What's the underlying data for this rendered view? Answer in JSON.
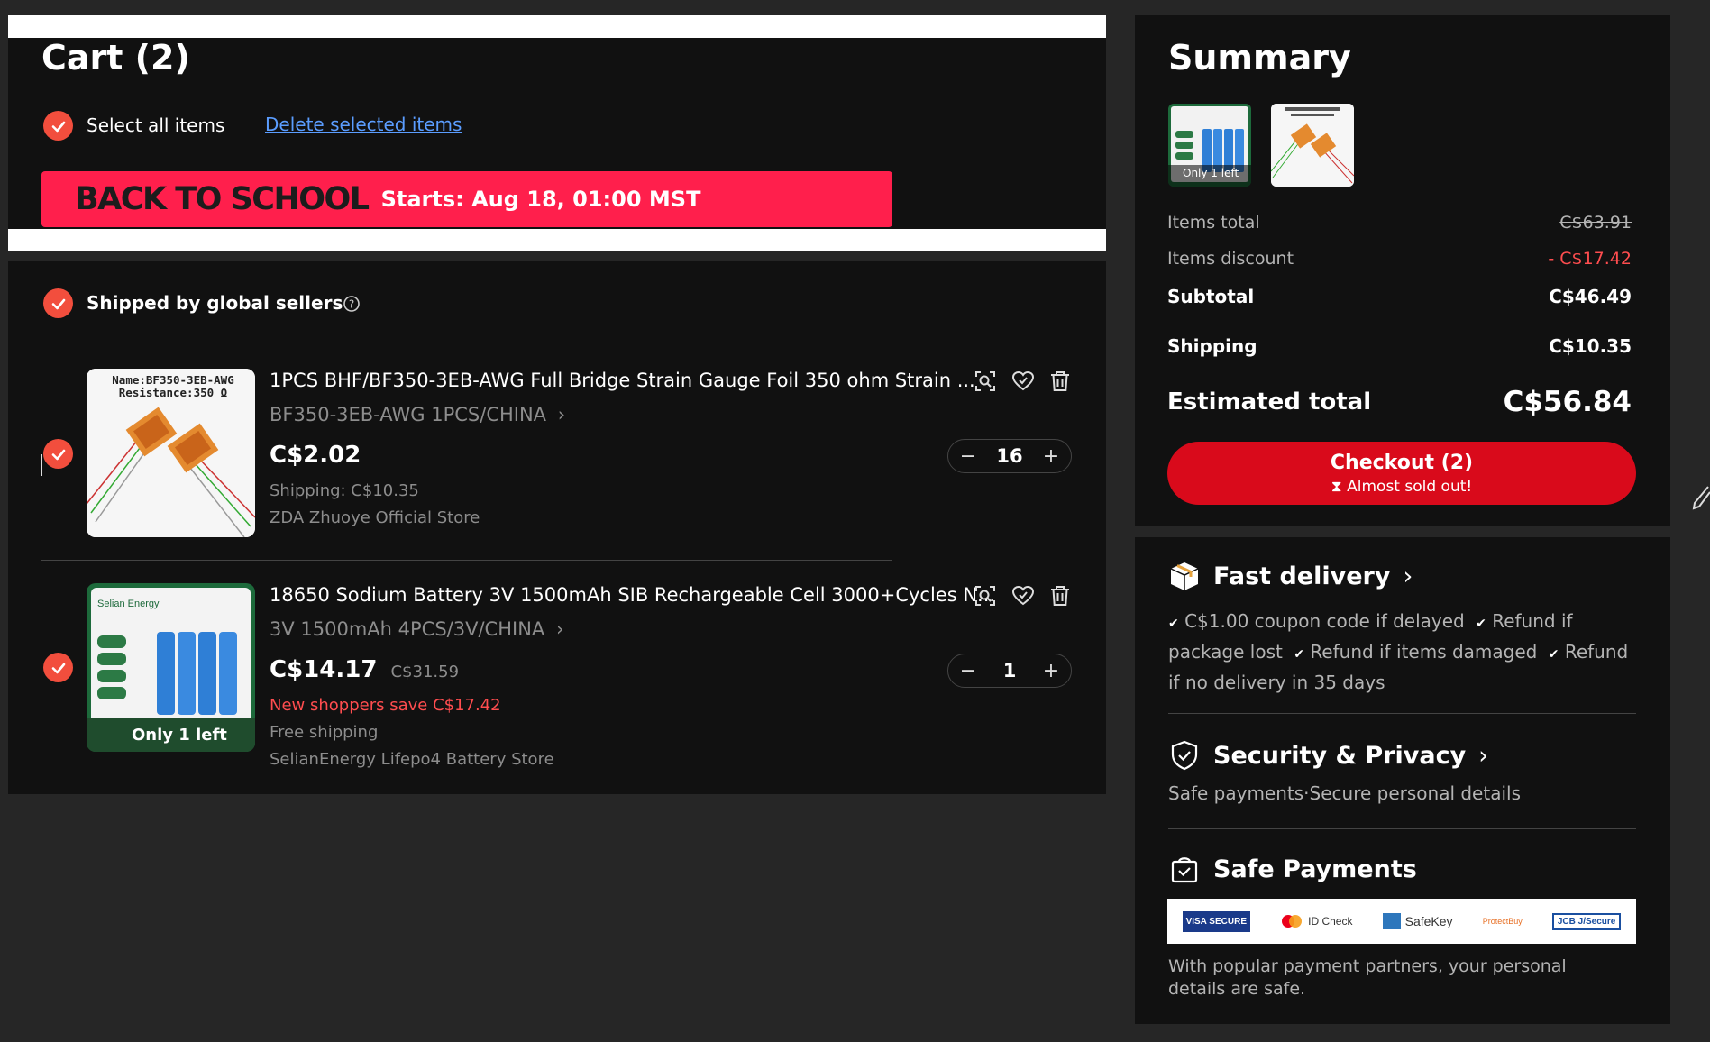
{
  "cart": {
    "title": "Cart (2)",
    "select_all": "Select all items",
    "delete_selected": "Delete selected items",
    "banner": {
      "title": "BACK TO SCHOOL",
      "starts": "Starts: Aug 18, 01:00 MST"
    },
    "group": {
      "label": "Shipped by global sellers"
    },
    "items": [
      {
        "title": "1PCS BHF/BF350-3EB-AWG Full Bridge Strain Gauge Foil 350 ohm Strain ...",
        "variant": "BF350-3EB-AWG 1PCS/CHINA",
        "price": "C$2.02",
        "shipping": "Shipping: C$10.35",
        "store": "ZDA Zhuoye Official Store",
        "quantity": "16",
        "image_text": {
          "line1": "Name:BF350-3EB-AWG",
          "line2": "Resistance:350 Ω"
        }
      },
      {
        "title": "18650 Sodium Battery 3V 1500mAh SIB Rechargeable Cell 3000+Cycles N...",
        "variant": "3V 1500mAh 4PCS/3V/CHINA",
        "price": "C$14.17",
        "original_price": "C$31.59",
        "promo": "New shoppers save C$17.42",
        "shipping": "Free shipping",
        "store": "SelianEnergy Lifepo4 Battery Store",
        "quantity": "1",
        "image_text": {
          "brand": "Selian Energy",
          "badge": "Only 1 left"
        }
      }
    ]
  },
  "summary": {
    "title": "Summary",
    "thumb_badge": "Only 1 left",
    "items_total_label": "Items total",
    "items_total_value": "C$63.91",
    "discount_label": "Items discount",
    "discount_value": "- C$17.42",
    "subtotal_label": "Subtotal",
    "subtotal_value": "C$46.49",
    "shipping_label": "Shipping",
    "shipping_value": "C$10.35",
    "estimated_label": "Estimated total",
    "estimated_value": "C$56.84",
    "checkout_label": "Checkout (2)",
    "checkout_sub": "Almost sold out!"
  },
  "delivery": {
    "title": "Fast delivery",
    "points": [
      "C$1.00 coupon code if delayed",
      "Refund if package lost",
      "Refund if items damaged",
      "Refund if no delivery in 35 days"
    ]
  },
  "security": {
    "title": "Security & Privacy",
    "desc": "Safe payments·Secure personal details"
  },
  "payments": {
    "title": "Safe Payments",
    "logos": [
      "VISA SECURE",
      "ID Check",
      "SafeKey",
      "ProtectBuy",
      "JCB J/Secure"
    ],
    "desc": "With popular payment partners, your personal details are safe."
  },
  "colors": {
    "accent": "#f24e3d",
    "checkout": "#d90a1b",
    "banner": "#ff1f4c",
    "discount": "#ff4d4f"
  }
}
